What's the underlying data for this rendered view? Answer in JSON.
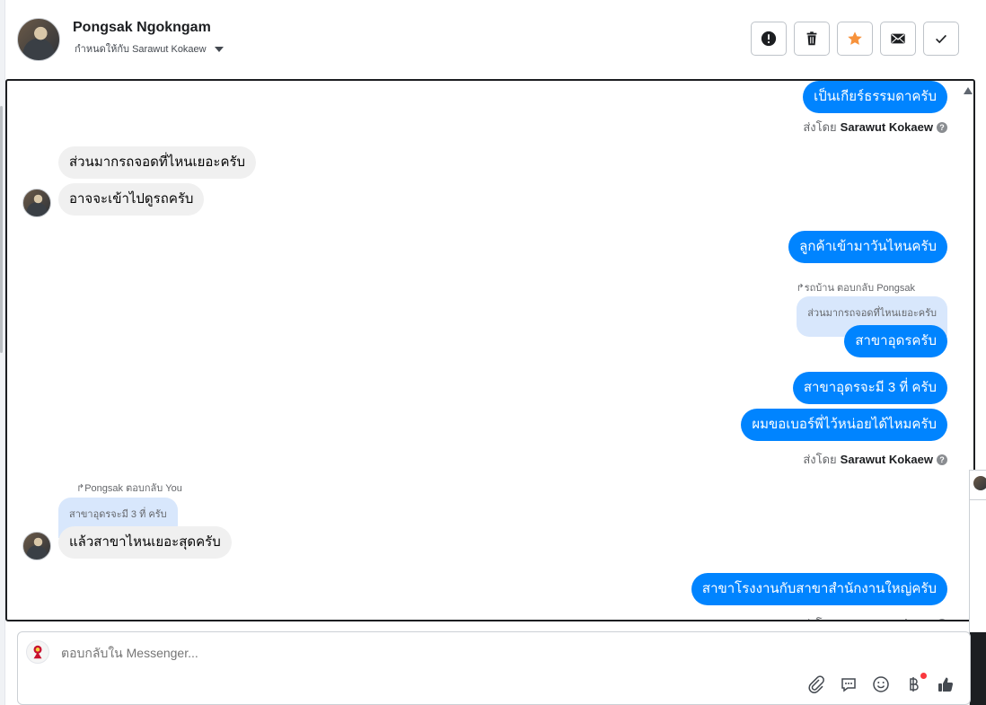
{
  "header": {
    "contact_name": "Pongsak Ngokngam",
    "assigned_to": "กำหนดให้กับ Sarawut Kokaew"
  },
  "toolbar": {
    "buttons": [
      "report-spam",
      "delete",
      "star",
      "mark-unread",
      "mark-done"
    ],
    "star_color": "#f7923b"
  },
  "messages": {
    "m1": "เป็นเกียร์ธรรมดาครับ",
    "m2": "ส่วนมากรถจอดที่ไหนเยอะครับ",
    "m3": "อาจจะเข้าไปดูรถครับ",
    "m4": "ลูกค้าเข้ามาวันไหนครับ",
    "m5": "สาขาอุดรครับ",
    "m6": "สาขาอุดรจะมี 3 ที่ ครับ",
    "m7": "ผมขอเบอร์พี่ไว้หน่อยได้ไหมครับ",
    "m8": "แล้วสาขาไหนเยอะสุดครับ",
    "m9": "สาขาโรงงานกับสาขาสำนักงานใหญ่ครับ"
  },
  "replies": {
    "r1_header": "↱รถบ้าน ตอบกลับ Pongsak",
    "r1_quote": "ส่วนมากรถจอดที่ไหนเยอะครับ",
    "r2_header": "↱Pongsak ตอบกลับ You",
    "r2_quote": "สาขาอุดรจะมี 3 ที่ ครับ"
  },
  "sent_by": {
    "prefix": "ส่งโดย",
    "agent": "Sarawut Kokaew",
    "help": "?"
  },
  "composer": {
    "placeholder": "ตอบกลับใน Messenger...",
    "actions": [
      "attach",
      "saved-replies",
      "emoji",
      "payment",
      "like"
    ]
  },
  "colors": {
    "outgoing": "#0084ff",
    "incoming": "#f0f0f0",
    "quote": "#d8e7fc"
  }
}
